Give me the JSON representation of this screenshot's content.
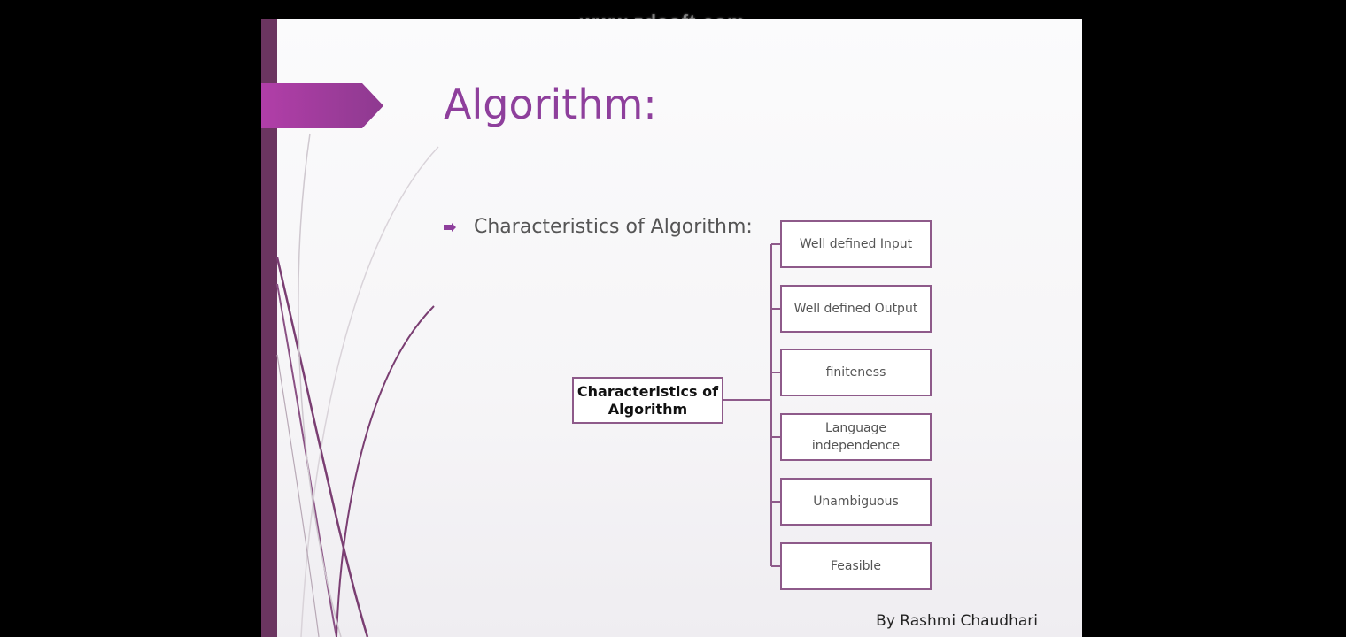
{
  "watermark": "www.zdsoft.com",
  "slide": {
    "title": "Algorithm:",
    "bullet": "Characteristics of Algorithm:",
    "diagram": {
      "root": "Characteristics of Algorithm",
      "children": [
        "Well defined Input",
        "Well defined Output",
        "finiteness",
        "Language independence",
        "Unambiguous",
        "Feasible"
      ]
    },
    "author": "By Rashmi Chaudhari"
  },
  "colors": {
    "accent": "#8e3f9c",
    "bar": "#6b3560",
    "box_border": "#8e5a8a"
  }
}
